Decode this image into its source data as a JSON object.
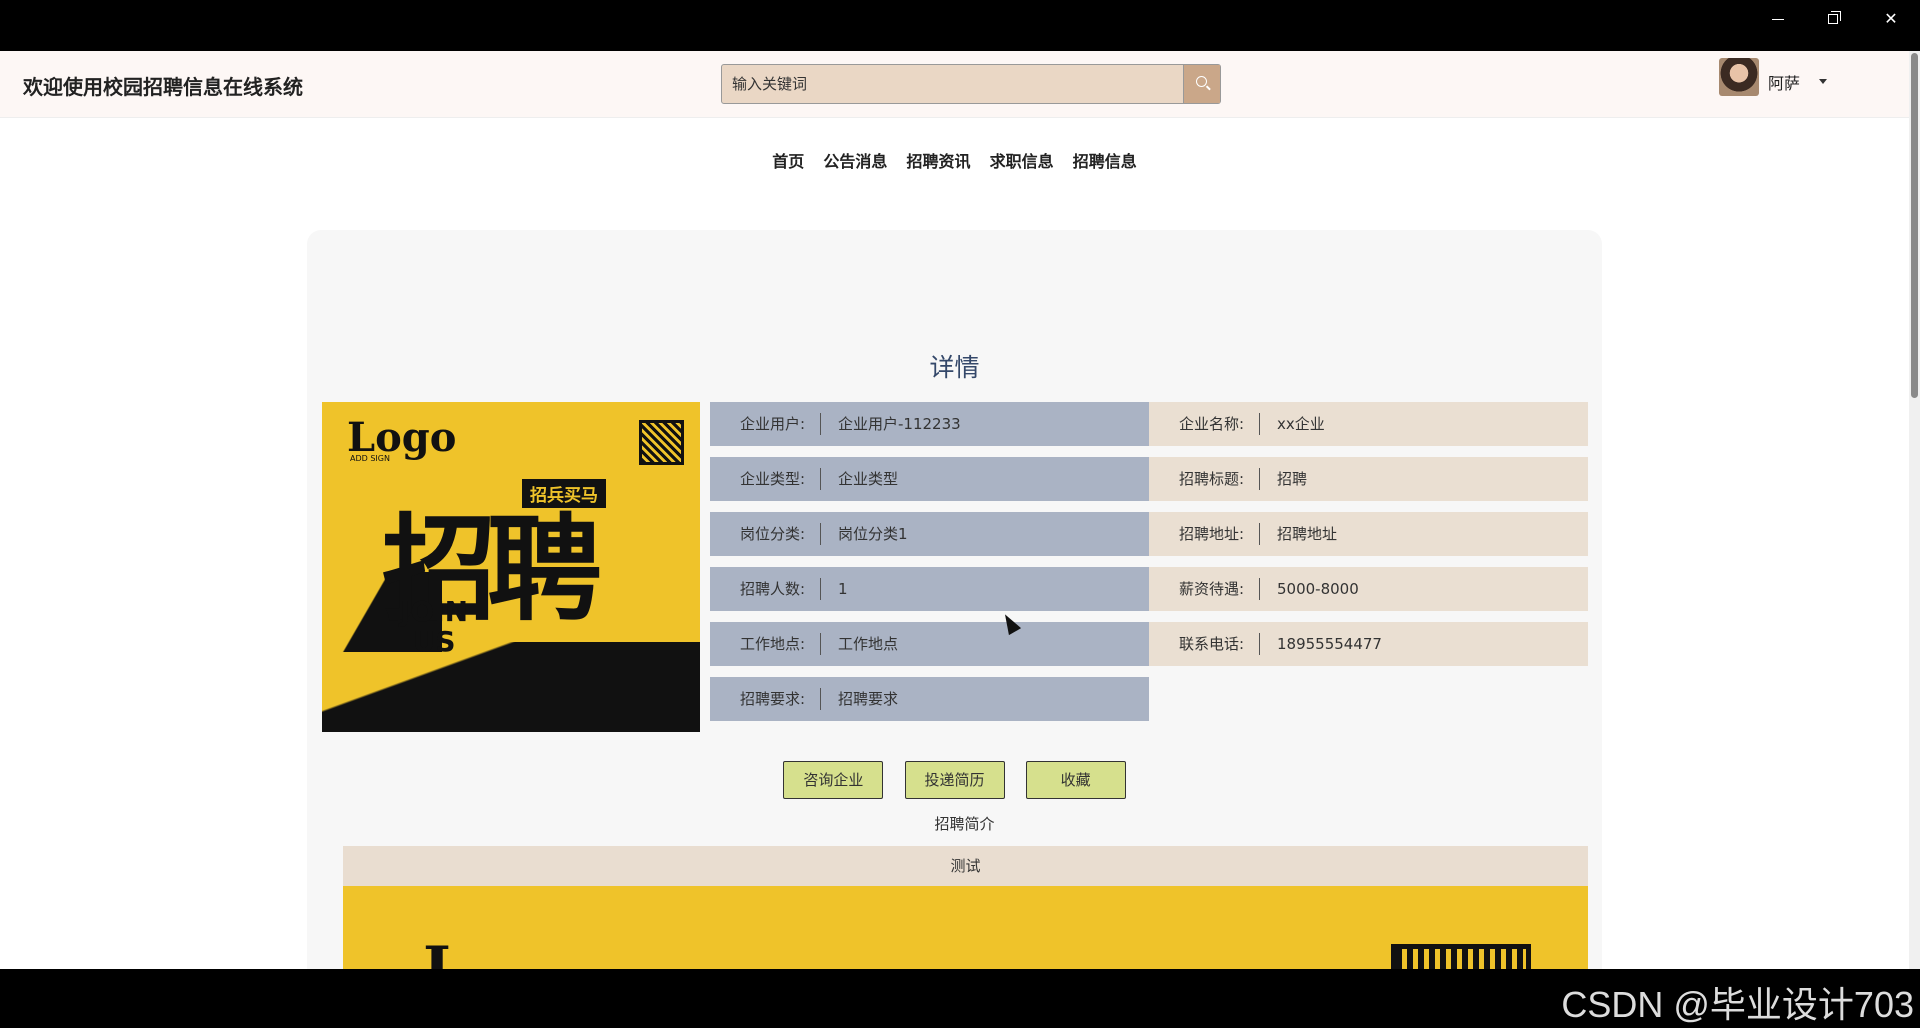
{
  "topbar": {
    "site_title": "欢迎使用校园招聘信息在线系统",
    "search_placeholder": "输入关键词",
    "user_name": "阿萨"
  },
  "nav": [
    "首页",
    "公告消息",
    "招聘资讯",
    "求职信息",
    "招聘信息"
  ],
  "detail": {
    "title": "详情",
    "left_fields": [
      {
        "label": "企业用户:",
        "value": "企业用户-112233"
      },
      {
        "label": "企业类型:",
        "value": "企业类型"
      },
      {
        "label": "岗位分类:",
        "value": "岗位分类1"
      },
      {
        "label": "招聘人数:",
        "value": "1"
      },
      {
        "label": "工作地点:",
        "value": "工作地点"
      },
      {
        "label": "招聘要求:",
        "value": "招聘要求"
      }
    ],
    "right_fields": [
      {
        "label": "企业名称:",
        "value": "xx企业"
      },
      {
        "label": "招聘标题:",
        "value": "招聘"
      },
      {
        "label": "招聘地址:",
        "value": "招聘地址"
      },
      {
        "label": "薪资待遇:",
        "value": "5000-8000"
      },
      {
        "label": "联系电话:",
        "value": "18955554477"
      }
    ],
    "buttons": [
      "咨询企业",
      "投递简历",
      "收藏"
    ],
    "intro_title": "招聘简介",
    "intro_text": "测试"
  },
  "poster": {
    "logo": "Logo",
    "add_sign": "ADD SIGN",
    "headline": "招聘",
    "tag": "招兵买马",
    "join_line1": "JOIN",
    "join_line2": "US"
  },
  "intro_image": {
    "logo": "L"
  },
  "watermark": "CSDN @毕业设计703",
  "colors": {
    "blue_row": "#aab3c4",
    "beige_row": "#eadfd2",
    "button": "#d6e08d",
    "poster": "#efc32a"
  }
}
